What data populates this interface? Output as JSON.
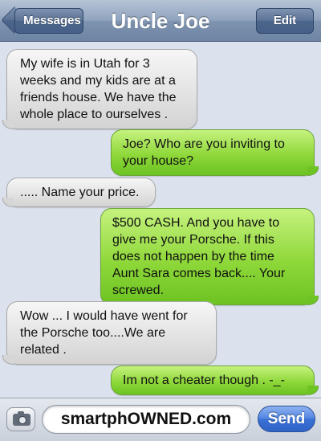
{
  "nav": {
    "back_label": "Messages",
    "title": "Uncle Joe",
    "edit_label": "Edit"
  },
  "messages": [
    {
      "sender": "contact",
      "text": "My wife is in Utah for 3 weeks and my kids are at a friends house. We have the whole place to ourselves ."
    },
    {
      "sender": "me",
      "text": "Joe? Who are you inviting to your house?"
    },
    {
      "sender": "contact",
      "text": "..... Name your price."
    },
    {
      "sender": "me",
      "text": "$500 CASH. And you have to give me your Porsche. If this does not happen by the time Aunt Sara comes back.... Your screwed."
    },
    {
      "sender": "contact",
      "text": "Wow ... I would have went for the Porsche too....We are related ."
    },
    {
      "sender": "me",
      "text": "Im not a cheater though . -_-"
    }
  ],
  "input": {
    "value": "smartphOWNED.com",
    "send_label": "Send"
  },
  "colors": {
    "incoming_bubble": "#e3e3e3",
    "outgoing_bubble": "#8fd83a",
    "nav_bar": "#8fa3bd",
    "send_button": "#3a6fd4"
  },
  "icons": {
    "camera": "camera-icon"
  }
}
